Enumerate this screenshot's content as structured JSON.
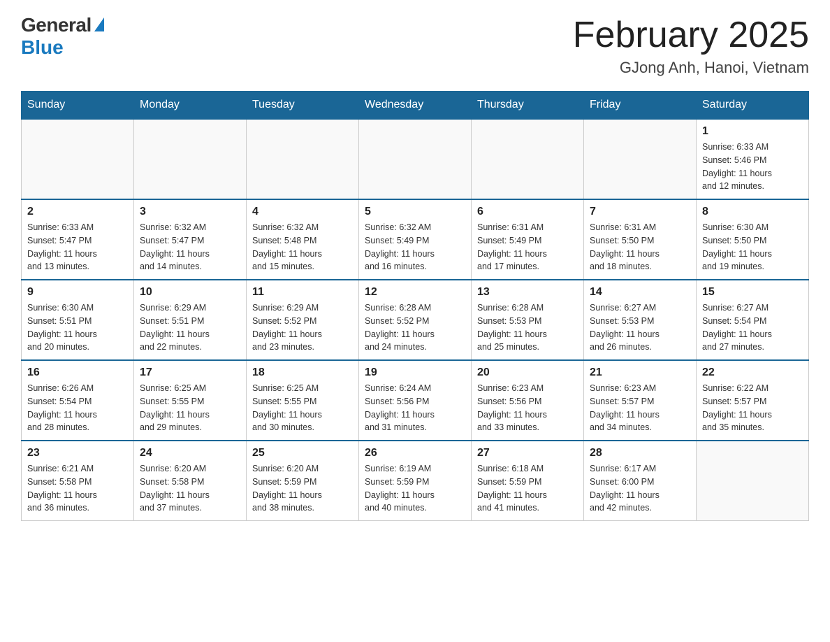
{
  "header": {
    "logo_general": "General",
    "logo_blue": "Blue",
    "title": "February 2025",
    "subtitle": "GJong Anh, Hanoi, Vietnam"
  },
  "days_of_week": [
    "Sunday",
    "Monday",
    "Tuesday",
    "Wednesday",
    "Thursday",
    "Friday",
    "Saturday"
  ],
  "weeks": [
    {
      "days": [
        {
          "date": "",
          "info": ""
        },
        {
          "date": "",
          "info": ""
        },
        {
          "date": "",
          "info": ""
        },
        {
          "date": "",
          "info": ""
        },
        {
          "date": "",
          "info": ""
        },
        {
          "date": "",
          "info": ""
        },
        {
          "date": "1",
          "info": "Sunrise: 6:33 AM\nSunset: 5:46 PM\nDaylight: 11 hours\nand 12 minutes."
        }
      ]
    },
    {
      "days": [
        {
          "date": "2",
          "info": "Sunrise: 6:33 AM\nSunset: 5:47 PM\nDaylight: 11 hours\nand 13 minutes."
        },
        {
          "date": "3",
          "info": "Sunrise: 6:32 AM\nSunset: 5:47 PM\nDaylight: 11 hours\nand 14 minutes."
        },
        {
          "date": "4",
          "info": "Sunrise: 6:32 AM\nSunset: 5:48 PM\nDaylight: 11 hours\nand 15 minutes."
        },
        {
          "date": "5",
          "info": "Sunrise: 6:32 AM\nSunset: 5:49 PM\nDaylight: 11 hours\nand 16 minutes."
        },
        {
          "date": "6",
          "info": "Sunrise: 6:31 AM\nSunset: 5:49 PM\nDaylight: 11 hours\nand 17 minutes."
        },
        {
          "date": "7",
          "info": "Sunrise: 6:31 AM\nSunset: 5:50 PM\nDaylight: 11 hours\nand 18 minutes."
        },
        {
          "date": "8",
          "info": "Sunrise: 6:30 AM\nSunset: 5:50 PM\nDaylight: 11 hours\nand 19 minutes."
        }
      ]
    },
    {
      "days": [
        {
          "date": "9",
          "info": "Sunrise: 6:30 AM\nSunset: 5:51 PM\nDaylight: 11 hours\nand 20 minutes."
        },
        {
          "date": "10",
          "info": "Sunrise: 6:29 AM\nSunset: 5:51 PM\nDaylight: 11 hours\nand 22 minutes."
        },
        {
          "date": "11",
          "info": "Sunrise: 6:29 AM\nSunset: 5:52 PM\nDaylight: 11 hours\nand 23 minutes."
        },
        {
          "date": "12",
          "info": "Sunrise: 6:28 AM\nSunset: 5:52 PM\nDaylight: 11 hours\nand 24 minutes."
        },
        {
          "date": "13",
          "info": "Sunrise: 6:28 AM\nSunset: 5:53 PM\nDaylight: 11 hours\nand 25 minutes."
        },
        {
          "date": "14",
          "info": "Sunrise: 6:27 AM\nSunset: 5:53 PM\nDaylight: 11 hours\nand 26 minutes."
        },
        {
          "date": "15",
          "info": "Sunrise: 6:27 AM\nSunset: 5:54 PM\nDaylight: 11 hours\nand 27 minutes."
        }
      ]
    },
    {
      "days": [
        {
          "date": "16",
          "info": "Sunrise: 6:26 AM\nSunset: 5:54 PM\nDaylight: 11 hours\nand 28 minutes."
        },
        {
          "date": "17",
          "info": "Sunrise: 6:25 AM\nSunset: 5:55 PM\nDaylight: 11 hours\nand 29 minutes."
        },
        {
          "date": "18",
          "info": "Sunrise: 6:25 AM\nSunset: 5:55 PM\nDaylight: 11 hours\nand 30 minutes."
        },
        {
          "date": "19",
          "info": "Sunrise: 6:24 AM\nSunset: 5:56 PM\nDaylight: 11 hours\nand 31 minutes."
        },
        {
          "date": "20",
          "info": "Sunrise: 6:23 AM\nSunset: 5:56 PM\nDaylight: 11 hours\nand 33 minutes."
        },
        {
          "date": "21",
          "info": "Sunrise: 6:23 AM\nSunset: 5:57 PM\nDaylight: 11 hours\nand 34 minutes."
        },
        {
          "date": "22",
          "info": "Sunrise: 6:22 AM\nSunset: 5:57 PM\nDaylight: 11 hours\nand 35 minutes."
        }
      ]
    },
    {
      "days": [
        {
          "date": "23",
          "info": "Sunrise: 6:21 AM\nSunset: 5:58 PM\nDaylight: 11 hours\nand 36 minutes."
        },
        {
          "date": "24",
          "info": "Sunrise: 6:20 AM\nSunset: 5:58 PM\nDaylight: 11 hours\nand 37 minutes."
        },
        {
          "date": "25",
          "info": "Sunrise: 6:20 AM\nSunset: 5:59 PM\nDaylight: 11 hours\nand 38 minutes."
        },
        {
          "date": "26",
          "info": "Sunrise: 6:19 AM\nSunset: 5:59 PM\nDaylight: 11 hours\nand 40 minutes."
        },
        {
          "date": "27",
          "info": "Sunrise: 6:18 AM\nSunset: 5:59 PM\nDaylight: 11 hours\nand 41 minutes."
        },
        {
          "date": "28",
          "info": "Sunrise: 6:17 AM\nSunset: 6:00 PM\nDaylight: 11 hours\nand 42 minutes."
        },
        {
          "date": "",
          "info": ""
        }
      ]
    }
  ]
}
